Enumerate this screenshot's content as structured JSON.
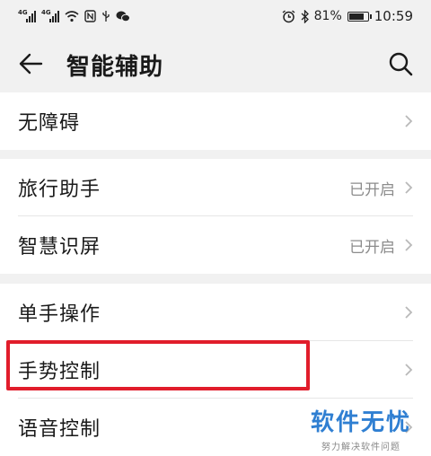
{
  "status": {
    "left_labels": [
      "4G",
      "4G"
    ],
    "battery": "81%",
    "time": "10:59"
  },
  "header": {
    "title": "智能辅助"
  },
  "sections": [
    {
      "items": [
        {
          "label": "无障碍",
          "value": ""
        }
      ]
    },
    {
      "items": [
        {
          "label": "旅行助手",
          "value": "已开启"
        },
        {
          "label": "智慧识屏",
          "value": "已开启"
        }
      ]
    },
    {
      "items": [
        {
          "label": "单手操作",
          "value": ""
        },
        {
          "label": "手势控制",
          "value": ""
        },
        {
          "label": "语音控制",
          "value": ""
        }
      ]
    }
  ],
  "watermark": {
    "main": "软件无忧",
    "sub": "努力解决软件问题"
  },
  "colors": {
    "highlight": "#e11d2b",
    "watermark": "#2f7fd2"
  }
}
